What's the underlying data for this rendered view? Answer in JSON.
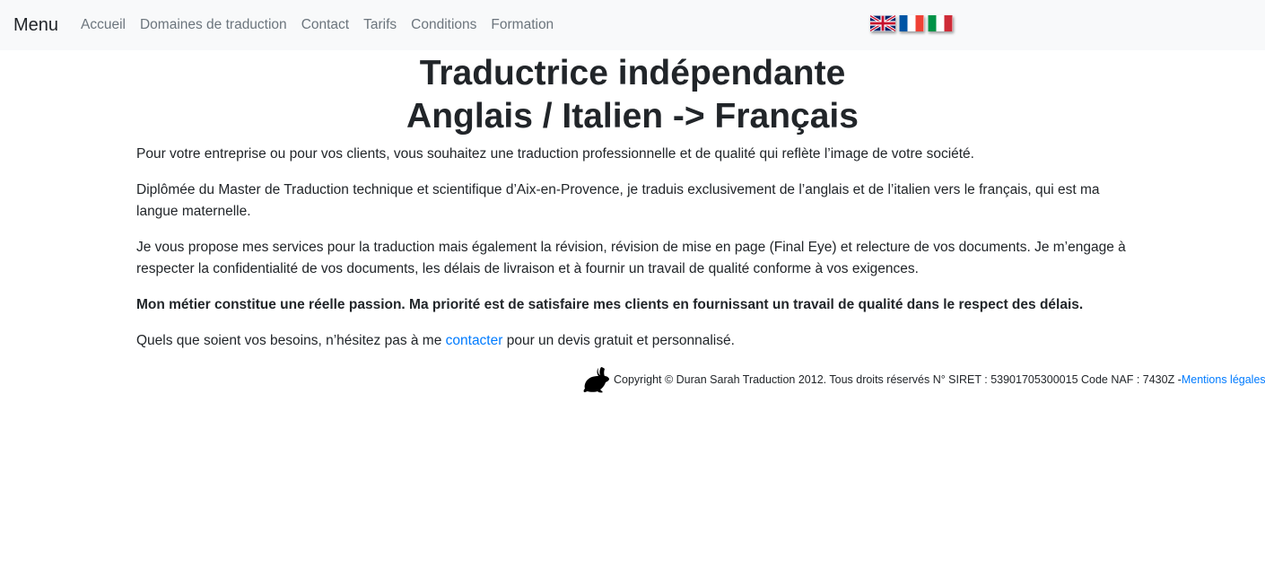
{
  "navbar": {
    "brand": "Menu",
    "links": [
      "Accueil",
      "Domaines de traduction",
      "Contact",
      "Tarifs",
      "Conditions",
      "Formation"
    ]
  },
  "flags": [
    "uk-flag-icon",
    "france-flag-icon",
    "italy-flag-icon"
  ],
  "header": {
    "title_line1": "Traductrice indépendante",
    "title_line2": "Anglais / Italien -> Français"
  },
  "content": {
    "p1": "Pour votre entreprise ou pour vos clients, vous souhaitez une traduction professionnelle et de qualité qui reflète l’image de votre société.",
    "p2": "Diplômée du Master de Traduction technique et scientifique d’Aix-en-Provence, je traduis exclusivement de l’anglais et de l’italien vers le français, qui est ma langue maternelle.",
    "p3": "Je vous propose mes services pour la traduction mais également la révision, révision de mise en page (Final Eye) et relecture de vos documents. Je m’engage à respecter la confidentialité de vos documents, les délais de livraison et à fournir un travail de qualité conforme à vos exigences.",
    "p4": "Mon métier constitue une réelle passion. Ma priorité est de satisfaire mes clients en fournissant un travail de qualité dans le respect des délais.",
    "p5_before": "Quels que soient vos besoins, n’hésitez pas à me ",
    "p5_link": "contacter",
    "p5_after": " pour un devis gratuit et personnalisé."
  },
  "footer": {
    "logo": "rabbit-icon",
    "copyright": "Copyright © Duran Sarah Traduction 2012. Tous droits réservés N° SIRET : 53901705300015 Code NAF : 7430Z - ",
    "legal_link": "Mentions légales"
  },
  "colors": {
    "navbar_bg": "#f8f9fa",
    "nav_link": "#6c757d",
    "text": "#212529",
    "link": "#007bff"
  }
}
